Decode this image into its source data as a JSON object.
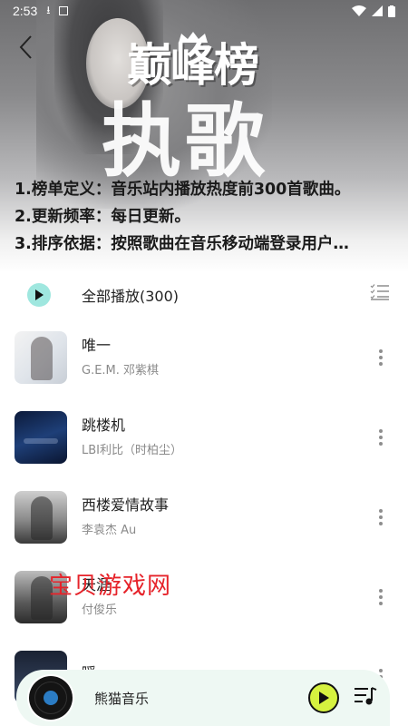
{
  "status_bar": {
    "time": "2:53"
  },
  "header": {
    "logo_text": "巅峰榜",
    "title": "执歌",
    "description": [
      "1.榜单定义：音乐站内播放热度前300首歌曲。",
      "2.更新频率：每日更新。",
      "3.排序依据：按照歌曲在音乐移动端登录用户…"
    ]
  },
  "play_all": {
    "label": "全部播放(300)"
  },
  "songs": [
    {
      "title": "唯一",
      "artist": "G.E.M. 邓紫棋"
    },
    {
      "title": "跳楼机",
      "artist": "LBI利比（时柏尘）"
    },
    {
      "title": "西楼爱情故事",
      "artist": "李袁杰 Au"
    },
    {
      "title": "天涯",
      "artist": "付俊乐"
    },
    {
      "title": "瞬",
      "artist": ""
    }
  ],
  "watermark": "宝贝游戏网",
  "mini_player": {
    "title": "熊猫音乐"
  },
  "colors": {
    "play_all_accent": "#9fe7df",
    "player_bg": "#eef8f3",
    "player_play_btn": "#d6f23f",
    "watermark": "#e6232a"
  }
}
